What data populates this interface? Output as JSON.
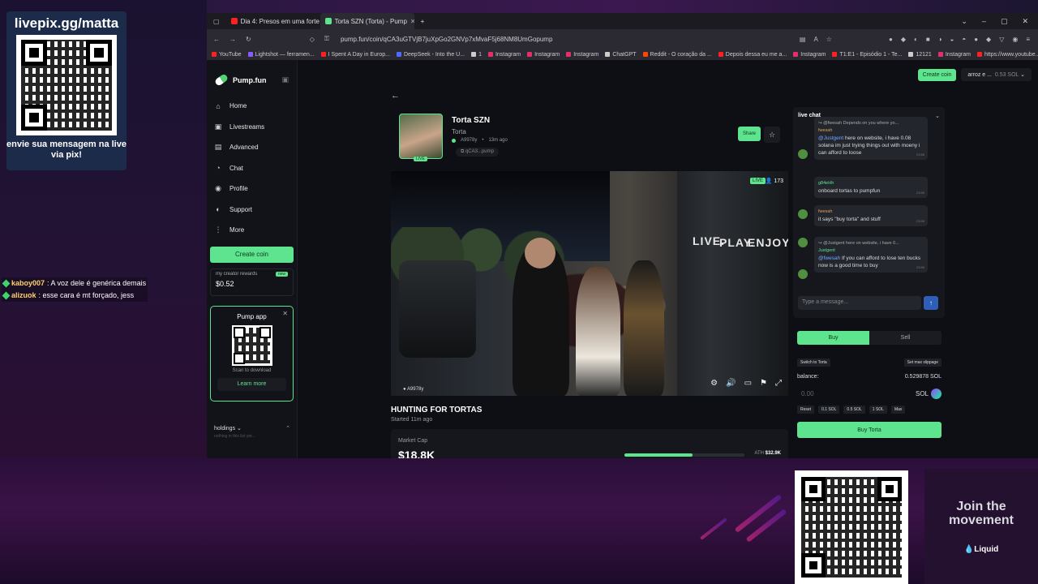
{
  "overlay": {
    "pix_title": "livepix.gg/matta",
    "pix_caption": "envie sua mensagem na live via pix!",
    "join_text": "Join the movement",
    "join_brand": "Liquid"
  },
  "stream_chat": [
    {
      "user": "kaboy007",
      "text": ": A voz dele é genérica demais"
    },
    {
      "user": "alizuok",
      "text": ": esse cara é mt forçado, jess"
    }
  ],
  "browser": {
    "tabs": [
      {
        "title": "Dia 4: Presos em uma forte ten",
        "color": "#ff2020"
      },
      {
        "title": "Torta SZN (Torta) - Pump",
        "color": "#5ee38f"
      }
    ],
    "url": "pump.fun/coin/qCA3uGTVjB7juXpGo2GNVp7xMvaF5j68NM8UmGopump",
    "bookmarks": [
      {
        "label": "YouTube",
        "color": "#ff2020"
      },
      {
        "label": "Lightshot — ferramen...",
        "color": "#8a5cff"
      },
      {
        "label": "I Spent A Day in Europ...",
        "color": "#ff2020"
      },
      {
        "label": "DeepSeek - Into the U...",
        "color": "#4d6bfe"
      },
      {
        "label": "1",
        "color": "#cccccc"
      },
      {
        "label": "Instagram",
        "color": "#e1306c"
      },
      {
        "label": "Instagram",
        "color": "#e1306c"
      },
      {
        "label": "Instagram",
        "color": "#e1306c"
      },
      {
        "label": "ChatGPT",
        "color": "#cccccc"
      },
      {
        "label": "Reddit - O coração da ...",
        "color": "#ff4500"
      },
      {
        "label": "Depois dessa eu me a...",
        "color": "#ff2020"
      },
      {
        "label": "Instagram",
        "color": "#e1306c"
      },
      {
        "label": "T1:E1 - Episódio 1 - Te...",
        "color": "#ff2020"
      },
      {
        "label": "12121",
        "color": "#cccccc"
      },
      {
        "label": "Instagram",
        "color": "#e1306c"
      },
      {
        "label": "https://www.youtube...",
        "color": "#ff2020"
      }
    ]
  },
  "sidebar": {
    "brand": "Pump.fun",
    "items": [
      {
        "label": "Home",
        "icon": "⌂"
      },
      {
        "label": "Livestreams",
        "icon": "▣"
      },
      {
        "label": "Advanced",
        "icon": "▤"
      },
      {
        "label": "Chat",
        "icon": "◔"
      },
      {
        "label": "Profile",
        "icon": "◉"
      },
      {
        "label": "Support",
        "icon": "◐"
      },
      {
        "label": "More",
        "icon": "⋮"
      }
    ],
    "create_coin": "Create coin",
    "rewards_label": "my creator rewards",
    "rewards_new": "new",
    "rewards_value": "$0.52",
    "app_title": "Pump app",
    "app_scan": "Scan to download",
    "app_learn": "Learn more",
    "holdings": "holdings",
    "holdings_empty": "nothing in this list yet..."
  },
  "top": {
    "create_coin": "Create coin",
    "wallet_name": "arroz e ...",
    "wallet_balance": "0.53 SOL"
  },
  "coin": {
    "name": "Torta SZN",
    "ticker": "Torta",
    "creator": "A9978y",
    "age": "13m ago",
    "contract": "qCA3...pump",
    "share": "Share",
    "live_tag": "LIVE"
  },
  "video": {
    "live": "LIVE",
    "viewers": "173",
    "host": "A9978y",
    "sign1": "LIVE.",
    "sign2": "PLAY.",
    "sign3": "ENJOY."
  },
  "stream": {
    "title": "HUNTING FOR TORTAS",
    "started": "Started 11m ago",
    "mcap_label": "Market Cap",
    "mcap_value": "$18.8K",
    "progress": 0.57,
    "ath_label": "ATH",
    "ath_value": "$32.9K"
  },
  "chat": {
    "title": "live chat",
    "messages": [
      {
        "reply": "↪ @fwesah Depends on you where yo...",
        "user": "fwesah",
        "user_color": "u1",
        "mention": "@Justgent",
        "text": " here on website, i have 0.08 solana im just trying things out with moeny i can afford to loose",
        "ts": "23:56"
      },
      {
        "reply": "",
        "user": "g84eHh",
        "user_color": "u2",
        "mention": "",
        "text": "onboard tortas to pumpfun",
        "ts": "23:56"
      },
      {
        "reply": "",
        "user": "fwesah",
        "user_color": "u1",
        "mention": "",
        "text": "it says \"buy torta\" and stuff",
        "ts": "23:56"
      },
      {
        "reply": "↪ @Justgent here on website, i have 0...",
        "user": "Justgent",
        "user_color": "u2",
        "mention": "@fwesah",
        "text": " If you can afford to lose ten bucks now is a good time to buy",
        "ts": "23:56"
      }
    ],
    "placeholder": "Type a message..."
  },
  "trade": {
    "buy": "Buy",
    "sell": "Sell",
    "switch": "Switch to Torta",
    "slippage": "Set max slippage",
    "balance_label": "balance:",
    "balance_value": "0.529878 SOL",
    "amount": "0.00",
    "currency": "SOL",
    "quick": [
      "Reset",
      "0.1 SOL",
      "0.5 SOL",
      "1 SOL",
      "Max"
    ],
    "submit": "Buy Torta"
  }
}
